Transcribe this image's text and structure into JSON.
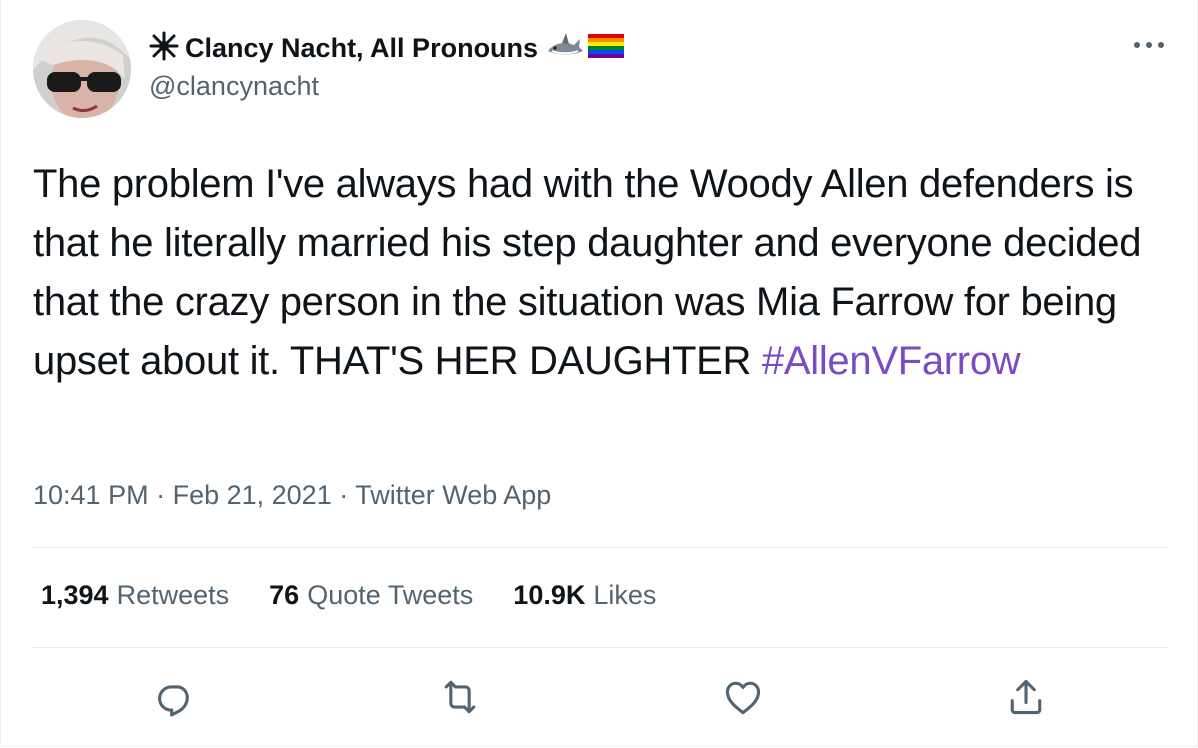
{
  "author": {
    "display_name": "Clancy Nacht, All Pronouns",
    "handle": "@clancynacht",
    "name_prefix_icon": "star-burst-icon",
    "name_suffix_icons": [
      "shark-icon",
      "rainbow-flag-icon"
    ]
  },
  "tweet": {
    "text": "The problem I've always had with the Woody Allen defenders is that he literally married his step daughter and everyone decided that the crazy person in the situation was Mia Farrow for being upset about it. THAT'S HER DAUGHTER ",
    "hashtag": "#AllenVFarrow",
    "time": "10:41 PM",
    "separator": " · ",
    "date": "Feb 21, 2021",
    "source": "Twitter Web App"
  },
  "stats": {
    "retweets_count": "1,394",
    "retweets_label": "Retweets",
    "quotes_count": "76",
    "quotes_label": "Quote Tweets",
    "likes_count": "10.9K",
    "likes_label": "Likes"
  },
  "actions": [
    "reply-icon",
    "retweet-icon",
    "like-icon",
    "share-icon"
  ],
  "colors": {
    "text": "#0f1419",
    "secondary": "#536471",
    "hashtag": "#794bc4",
    "divider": "#e6ecf0"
  }
}
